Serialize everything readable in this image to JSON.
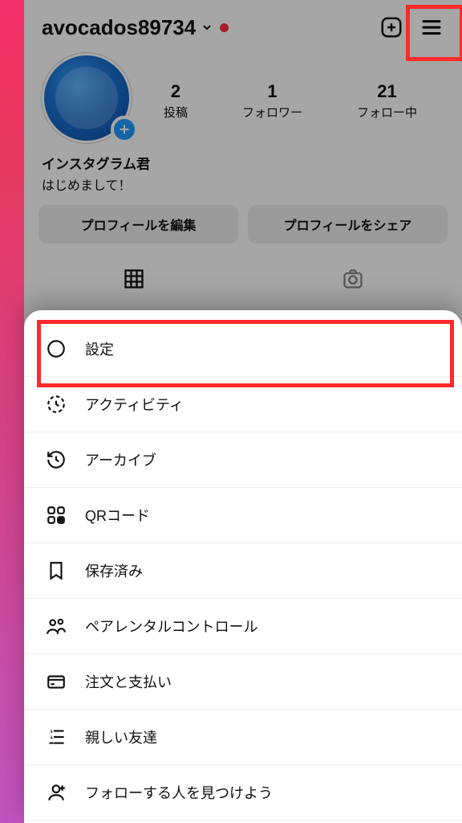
{
  "header": {
    "username": "avocados89734"
  },
  "stats": {
    "posts_n": "2",
    "posts_l": "投稿",
    "followers_n": "1",
    "followers_l": "フォロワー",
    "following_n": "21",
    "following_l": "フォロー中"
  },
  "bio": {
    "display_name": "インスタグラム君",
    "text": "はじめまして！"
  },
  "buttons": {
    "edit": "プロフィールを編集",
    "share": "プロフィールをシェア"
  },
  "menu": {
    "settings": "設定",
    "activity": "アクティビティ",
    "archive": "アーカイブ",
    "qr": "QRコード",
    "saved": "保存済み",
    "parental": "ペアレンタルコントロール",
    "orders": "注文と支払い",
    "close_friends": "親しい友達",
    "discover": "フォローする人を見つけよう"
  }
}
